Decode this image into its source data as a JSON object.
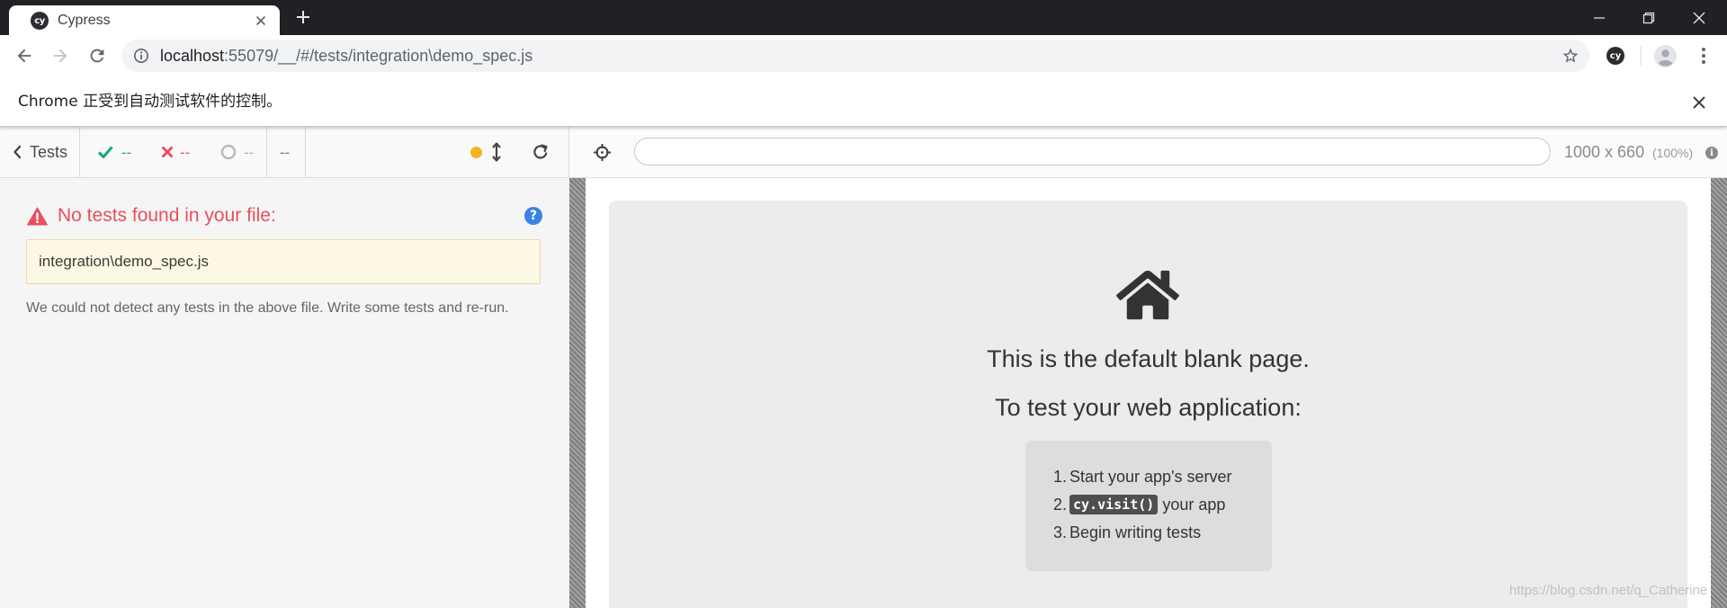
{
  "browser": {
    "tab": {
      "title": "Cypress",
      "logo_text": "cy"
    },
    "address": {
      "host": "localhost",
      "path": ":55079/__/#/tests/integration\\demo_spec.js"
    },
    "extension_logo_text": "cy"
  },
  "infobar": {
    "message": "Chrome 正受到自动测试软件的控制。"
  },
  "reporter": {
    "back_label": "Tests",
    "stats": {
      "passed": "--",
      "failed": "--",
      "pending": "--",
      "duration": "--"
    },
    "error": {
      "title": "No tests found in your file:",
      "file": "integration\\demo_spec.js",
      "message": "We could not detect any tests in the above file. Write some tests and re-run."
    }
  },
  "aut": {
    "url": "",
    "viewport": "1000 x 660",
    "scale": "(100%)",
    "blank_page": {
      "heading": "This is the default blank page.",
      "subheading": "To test your web application:",
      "steps": [
        {
          "num": "1.",
          "code": "",
          "text": "Start your app's server"
        },
        {
          "num": "2.",
          "code": "cy.visit()",
          "text": " your app"
        },
        {
          "num": "3.",
          "code": "",
          "text": "Begin writing tests"
        }
      ]
    }
  },
  "watermark": "https://blog.csdn.net/q_Catherine",
  "colors": {
    "frame": "#202124",
    "pass": "#1fa971",
    "fail": "#e94f5d",
    "pending": "#b8b8b8",
    "help": "#3b82e4",
    "running_indicator": "#f5b324",
    "file_box_bg": "#fdf8e3"
  },
  "icons": {
    "tab": [
      "cypress-logo-icon",
      "close-icon",
      "plus-icon"
    ],
    "window": [
      "minimize-icon",
      "restore-icon",
      "close-icon"
    ],
    "toolbar": [
      "back-arrow-icon",
      "forward-arrow-icon",
      "reload-icon",
      "info-icon",
      "star-icon",
      "cypress-extension-icon",
      "avatar-icon",
      "more-vert-icon"
    ],
    "reporter": [
      "chevron-left-icon",
      "check-icon",
      "x-icon",
      "pending-circle-icon",
      "running-dot-icon",
      "resize-vertical-icon",
      "rerun-icon",
      "warning-icon",
      "help-icon"
    ],
    "aut": [
      "crosshair-icon",
      "info-icon",
      "home-icon"
    ]
  }
}
